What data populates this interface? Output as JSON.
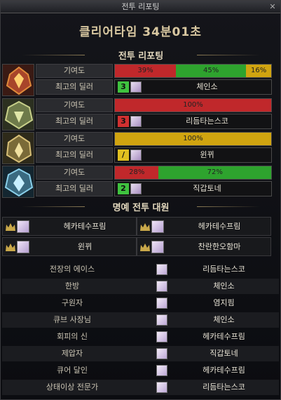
{
  "window": {
    "title": "전투 리포팅",
    "close_label": "✕"
  },
  "clear_time": "클리어타임 34분01초",
  "sections": {
    "report": "전투 리포팅",
    "honor": "명예 전투 대원"
  },
  "labels": {
    "contribution": "기여도",
    "best_dealer": "최고의 딜러"
  },
  "report_rows": [
    {
      "segments": [
        {
          "label": "39%",
          "value": 39,
          "color": "#c0282b"
        },
        {
          "label": "45%",
          "value": 45,
          "color": "#2ea32e"
        },
        {
          "label": "16%",
          "value": 16,
          "color": "#d0a410"
        }
      ],
      "rank": "3",
      "rank_color": "#3fc23f",
      "player": "체인소"
    },
    {
      "segments": [
        {
          "label": "100%",
          "value": 100,
          "color": "#c0282b"
        }
      ],
      "rank": "3",
      "rank_color": "#d03030",
      "player": "리듬타는스코"
    },
    {
      "segments": [
        {
          "label": "100%",
          "value": 100,
          "color": "#d0a410"
        }
      ],
      "rank": "/",
      "rank_color": "#e0c020",
      "player": "윈뀌"
    },
    {
      "segments": [
        {
          "label": "28%",
          "value": 28,
          "color": "#c0282b"
        },
        {
          "label": "72%",
          "value": 72,
          "color": "#2ea32e"
        }
      ],
      "rank": "2",
      "rank_color": "#3fc23f",
      "player": "직갑토네"
    }
  ],
  "honor": [
    "헤카테수프림",
    "헤카테수프림",
    "윈뀌",
    "찬란한오함마"
  ],
  "awards": [
    {
      "award": "전장의 에이스",
      "player": "리듬타는스코"
    },
    {
      "award": "한방",
      "player": "체인소"
    },
    {
      "award": "구원자",
      "player": "염지핌"
    },
    {
      "award": "큐브 사장님",
      "player": "체인소"
    },
    {
      "award": "회피의 신",
      "player": "헤카테수프림"
    },
    {
      "award": "제압자",
      "player": "직갑토네"
    },
    {
      "award": "큐어 달인",
      "player": "헤카테수프림"
    },
    {
      "award": "상태이상 전문가",
      "player": "리듬타는스코"
    }
  ]
}
